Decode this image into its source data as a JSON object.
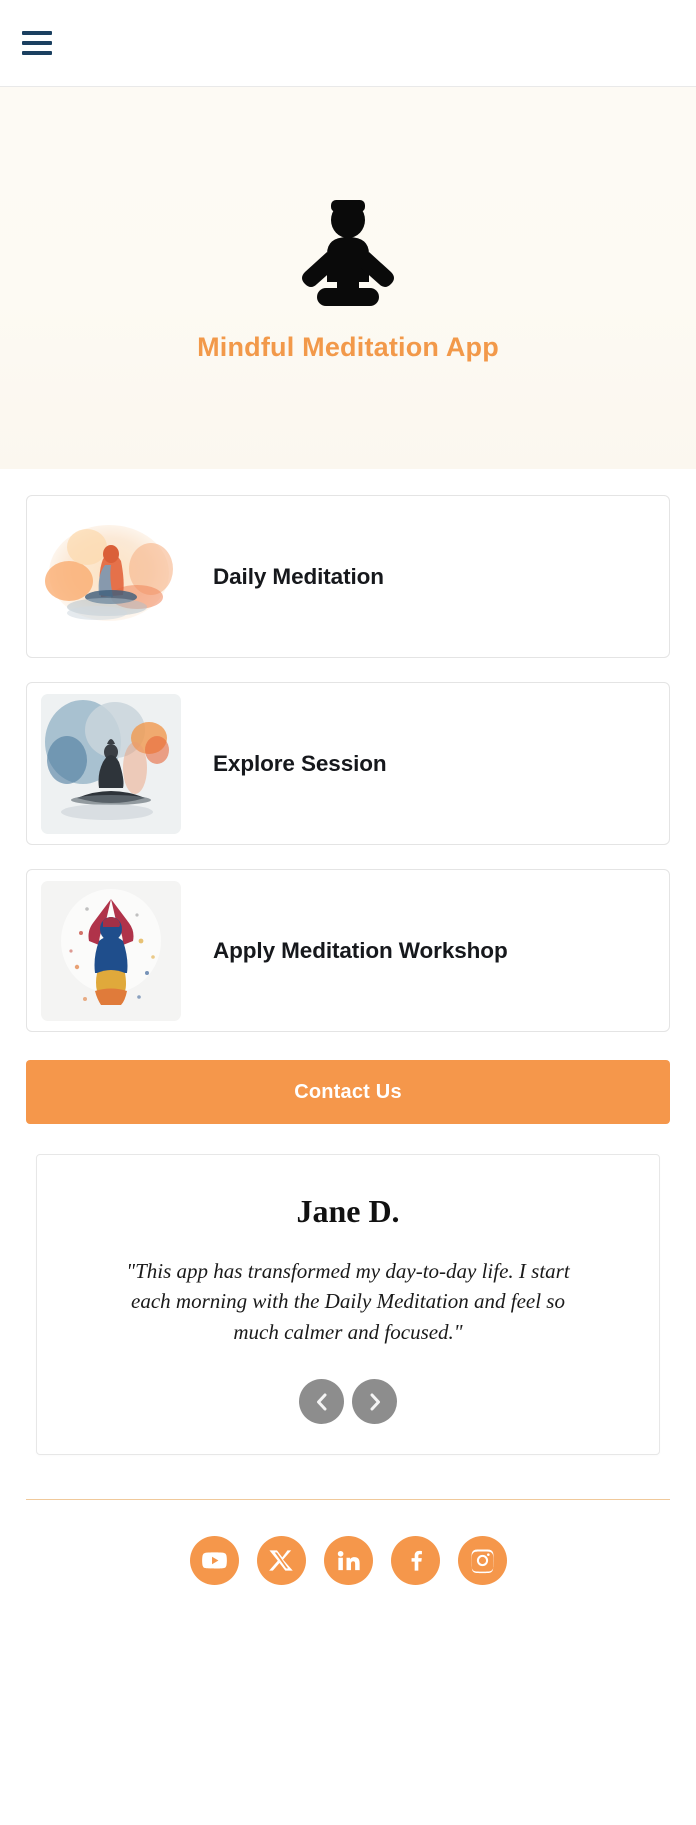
{
  "header": {
    "menu_icon": "hamburger-menu-icon",
    "menu_color": "#1b4060"
  },
  "hero": {
    "icon": "meditating-person-icon",
    "title": "Mindful Meditation App",
    "title_color": "#f2994a",
    "background_color": "#fdfaf4"
  },
  "cards": [
    {
      "label": "Daily Meditation",
      "image": "watercolor-meditating-figure-orange",
      "image_colors": [
        "#f4a06a",
        "#f58b50",
        "#7c9cb5",
        "#f6d7bd"
      ]
    },
    {
      "label": "Explore Session",
      "image": "watercolor-meditating-figure-blue-grey",
      "image_colors": [
        "#8aa6b8",
        "#4a5a66",
        "#f28f4a",
        "#dfe4e6"
      ]
    },
    {
      "label": "Apply Meditation Workshop",
      "image": "watercolor-yoga-figure-arms-raised-colorful",
      "image_colors": [
        "#1f4e8c",
        "#e0a93b",
        "#c0392b",
        "#f2f2f2"
      ]
    }
  ],
  "cta": {
    "label": "Contact Us",
    "background_color": "#f5974b",
    "text_color": "#ffffff"
  },
  "testimonial": {
    "name": "Jane D.",
    "quote": "\"This app has transformed my day-to-day life. I start each morning with the Daily Meditation and feel so much calmer and focused.\"",
    "prev_icon": "chevron-left-icon",
    "next_icon": "chevron-right-icon",
    "nav_color": "#8d8d8d"
  },
  "footer": {
    "divider_color": "#f0c99b",
    "social_color": "#f5974b",
    "social": [
      {
        "name": "youtube",
        "label": "YouTube"
      },
      {
        "name": "x-twitter",
        "label": "X"
      },
      {
        "name": "linkedin",
        "label": "LinkedIn"
      },
      {
        "name": "facebook",
        "label": "Facebook"
      },
      {
        "name": "instagram",
        "label": "Instagram"
      }
    ]
  }
}
